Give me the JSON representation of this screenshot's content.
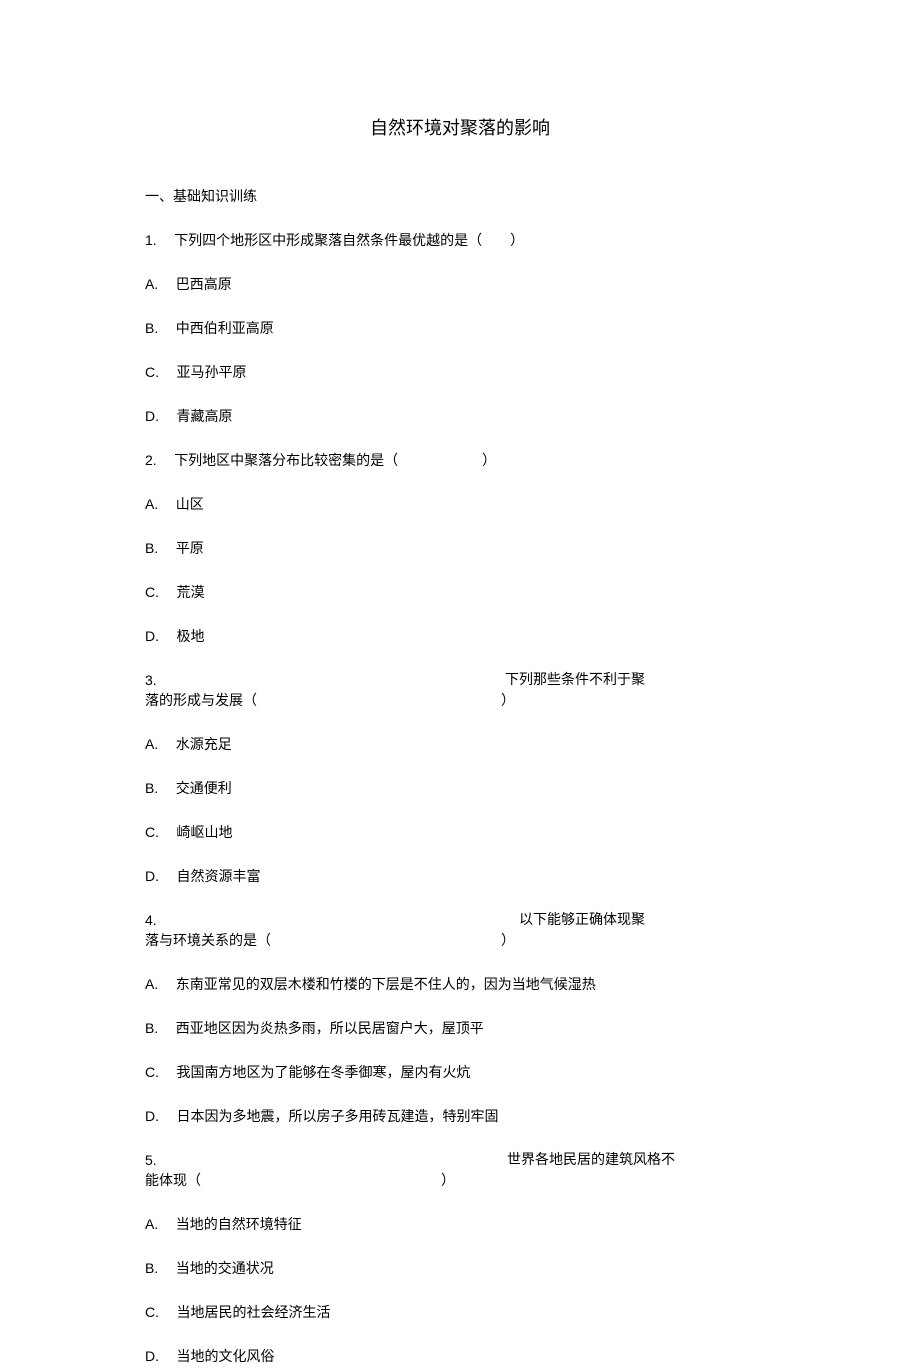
{
  "title": "自然环境对聚落的影响",
  "section1": "一、基础知识训练",
  "q1": {
    "num": "1.",
    "text": "下列四个地形区中形成聚落自然条件最优越的是（　　）",
    "a": "A.",
    "a_text": "巴西高原",
    "b": "B.",
    "b_text": "中西伯利亚高原",
    "c": "C.",
    "c_text": "亚马孙平原",
    "d": "D.",
    "d_text": "青藏高原"
  },
  "q2": {
    "num": "2.",
    "text": "下列地区中聚落分布比较密集的是（　　　　　　）",
    "a": "A.",
    "a_text": "山区",
    "b": "B.",
    "b_text": "平原",
    "c": "C.",
    "c_text": "荒漠",
    "d": "D.",
    "d_text": "极地"
  },
  "q3": {
    "num": "3.",
    "right1": "下列那些条件不利于聚",
    "left2": "落的形成与发展（",
    "right2": "）",
    "a": "A.",
    "a_text": "水源充足",
    "b": "B.",
    "b_text": "交通便利",
    "c": "C.",
    "c_text": "崎岖山地",
    "d": "D.",
    "d_text": "自然资源丰富"
  },
  "q4": {
    "num": "4.",
    "right1": "以下能够正确体现聚",
    "left2": "落与环境关系的是（",
    "right2": "）",
    "a": "A.",
    "a_text": "东南亚常见的双层木楼和竹楼的下层是不住人的，因为当地气候湿热",
    "b": "B.",
    "b_text": "西亚地区因为炎热多雨，所以民居窗户大，屋顶平",
    "c": "C.",
    "c_text": "我国南方地区为了能够在冬季御寒，屋内有火炕",
    "d": "D.",
    "d_text": "日本因为多地震，所以房子多用砖瓦建造，特别牢固"
  },
  "q5": {
    "num": "5.",
    "right1": "世界各地民居的建筑风格不",
    "left2": "能体现（",
    "right2": "）",
    "a": "A.",
    "a_text": "当地的自然环境特征",
    "b": "B.",
    "b_text": "当地的交通状况",
    "c": "C.",
    "c_text": "当地居民的社会经济生活",
    "d": "D.",
    "d_text": "当地的文化风俗"
  }
}
